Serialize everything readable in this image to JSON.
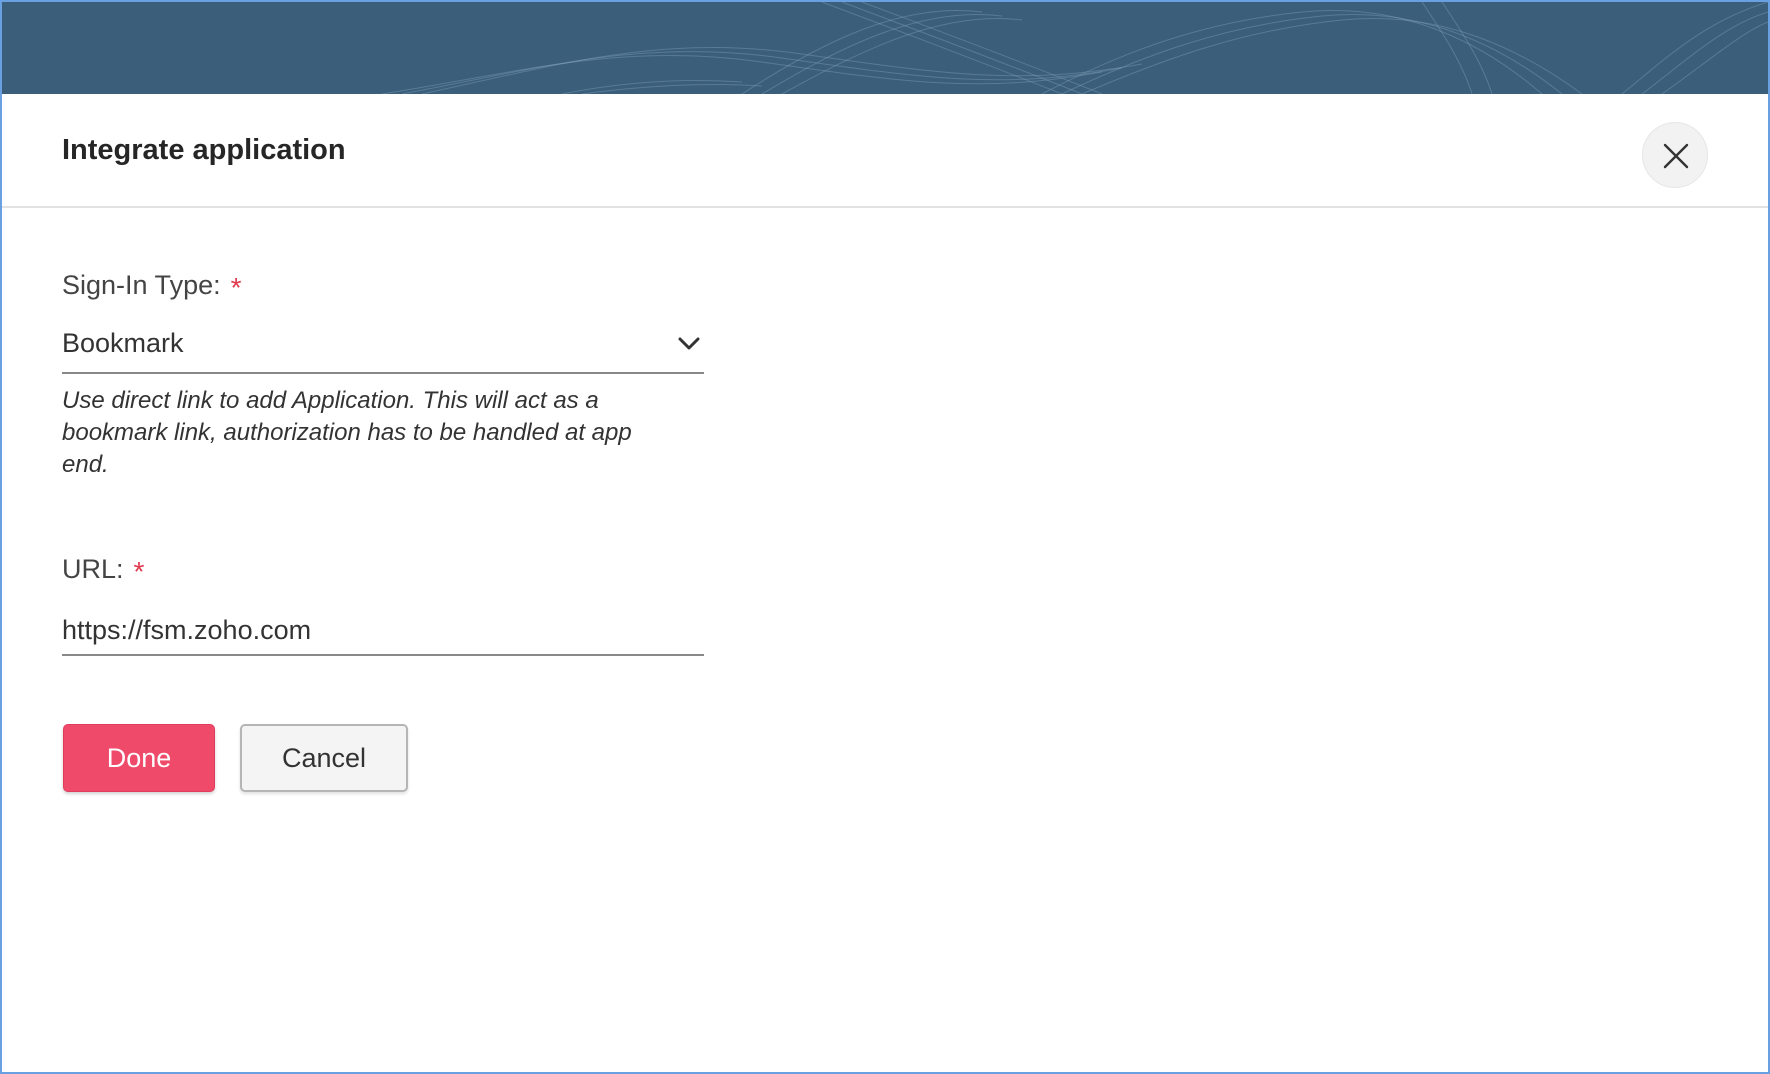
{
  "dialog": {
    "title": "Integrate application",
    "close_icon": "close-icon"
  },
  "form": {
    "sign_in_type": {
      "label": "Sign-In Type:",
      "required_mark": "*",
      "selected": "Bookmark",
      "icon": "chevron-down-icon",
      "help": "Use direct link to add Application. This will act as a bookmark link, authorization has to be handled at app end."
    },
    "url": {
      "label": "URL:",
      "required_mark": "*",
      "value": "https://fsm.zoho.com"
    }
  },
  "actions": {
    "done_label": "Done",
    "cancel_label": "Cancel"
  },
  "colors": {
    "banner": "#3b5f7b",
    "primary": "#ef4a6a",
    "required": "#e0384f",
    "frame_border": "#6aa0e0"
  }
}
